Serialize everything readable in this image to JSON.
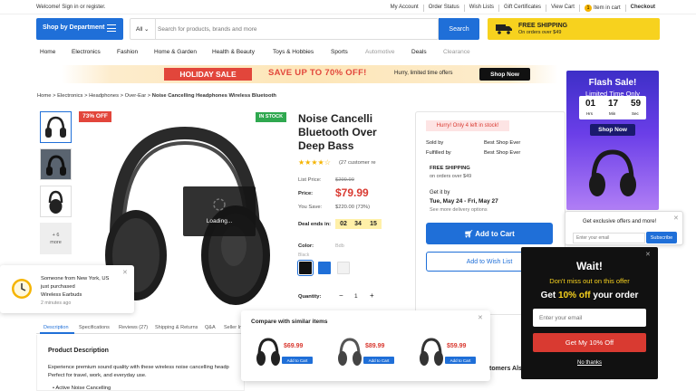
{
  "topbar": {
    "welcome": "Welcome! Sign in or register.",
    "links": [
      "My Account",
      "Order Status",
      "Wish Lists",
      "Gift Certificates",
      "View Cart"
    ],
    "cart_count": "1",
    "cart_label": "Item in cart",
    "checkout": "Checkout"
  },
  "header": {
    "dept_label": "Shop by Department",
    "search_category": "All",
    "search_placeholder": "Search for products, brands and more",
    "search_button": "Search",
    "ship_title": "FREE SHIPPING",
    "ship_sub": "On orders over $49"
  },
  "nav": [
    "Home",
    "Electronics",
    "Fashion",
    "Home & Garden",
    "Health & Beauty",
    "Toys & Hobbies",
    "Sports",
    "Automotive",
    "Deals",
    "Clearance"
  ],
  "promo": {
    "sale": "HOLIDAY SALE",
    "save": "SAVE UP TO 70% OFF!",
    "hurry": "Hurry, limited time offers",
    "shop_now": "Shop Now"
  },
  "breadcrumb": {
    "items": [
      "Home",
      "Electronics",
      "Headphones",
      "Over-Ear"
    ],
    "current": "Noise Cancelling Headphones Wireless Bluetooth",
    "sep": ">"
  },
  "gallery": {
    "more_count": "+ 6",
    "more_label": "more",
    "badge_off": "73% OFF",
    "badge_stock": "IN STOCK",
    "loading": "Loading..."
  },
  "product": {
    "title_lines": [
      "Noise Cancelli",
      "Bluetooth Over",
      "Deep Bass"
    ],
    "rating": 4.5,
    "stars": "★★★★☆",
    "reviews": "(27 customer re",
    "list_price_label": "List Price:",
    "list_price": "$299.99",
    "price_label": "Price:",
    "price": "$79.99",
    "save_label": "You Save:",
    "save": "$220.00 (73%)",
    "deal_label": "Deal ends in:",
    "countdown": [
      "02",
      "34",
      "15"
    ],
    "color_label": "Color:",
    "color_value": "Bdb",
    "color_sub": "Black",
    "swatches": [
      "#111111",
      "#1f6fd8",
      "#f2f2f2"
    ],
    "qty_label": "Quantity:",
    "qty": "1"
  },
  "buybox": {
    "hurry": "Hurry! Only 4 left in stock!",
    "sold_by_label": "Sold by",
    "sold_by": "Best Shop Ever",
    "fulfilled_label": "Fulfilled by",
    "fulfilled_by": "Best Shop Ever",
    "ship_title": "FREE SHIPPING",
    "ship_sub": "on orders over $49",
    "get_it": "Get it by",
    "date": "Tue, May 24 - Fri, May 27",
    "more_options": "See more delivery options",
    "add_to_cart": "Add to Cart",
    "add_to_wish": "Add to Wish List"
  },
  "flash": {
    "title": "Flash Sale!",
    "sub": "Limited Time Only",
    "timer": [
      "01",
      "17",
      "59"
    ],
    "units": [
      "Hrs",
      "Min",
      "Sec"
    ],
    "shop_now": "Shop Now"
  },
  "exclusive": {
    "text": "Get exclusive offers and more!",
    "placeholder": "Enter your email",
    "button": "Subscribe"
  },
  "notif": {
    "line1": "Someone from New York, US",
    "line2": "just purchased",
    "line3": "Wireless Earbuds",
    "time": "2 minutes ago"
  },
  "tabs": [
    "Description",
    "Specifications",
    "Reviews (27)",
    "Shipping & Returns",
    "Q&A",
    "Seller In"
  ],
  "description": {
    "heading": "Product Description",
    "body1": "Experience premium sound quality with these wireless noise cancelling headp",
    "body2": "Perfect for travel, work, and everyday use.",
    "bullet": "Active Noise Cancelling"
  },
  "compare": {
    "title": "Compare with similar items",
    "items": [
      {
        "price": "$69.99",
        "button": "Add to Cart"
      },
      {
        "price": "$89.99",
        "button": "Add to Cart"
      },
      {
        "price": "$59.99",
        "button": "Add to Cart"
      }
    ]
  },
  "wait": {
    "title": "Wait!",
    "sub": "Don't miss out on this offer",
    "offer_pre": "Get ",
    "offer_pct": "10% off",
    "offer_post": " your order",
    "placeholder": "Enter your email",
    "button": "Get My 10% Off",
    "decline": "No thanks"
  },
  "partial_heading": "tomers Als",
  "colors": {
    "accent": "#1f6fd8",
    "sale": "#e2463b",
    "yellow": "#f7d21e",
    "success": "#2fa84f"
  }
}
